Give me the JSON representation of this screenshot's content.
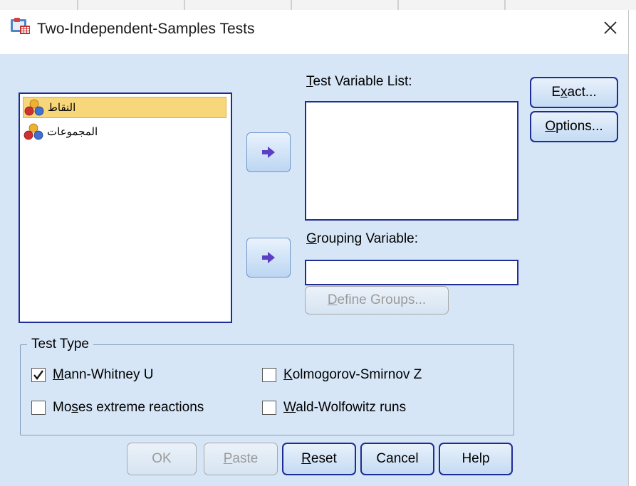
{
  "window": {
    "title": "Two-Independent-Samples Tests",
    "close_symbol": "✕"
  },
  "source_list": {
    "items": [
      {
        "label": "النقاط",
        "selected": true,
        "icon": "nominal-variable-icon"
      },
      {
        "label": "المجموعات",
        "selected": false,
        "icon": "nominal-variable-icon"
      }
    ]
  },
  "test_variable": {
    "label_key": "T",
    "label_rest": "est Variable List:"
  },
  "grouping_variable": {
    "label_key": "G",
    "label_rest": "rouping Variable:",
    "value": ""
  },
  "side_buttons": {
    "exact_pre": "E",
    "exact_key": "x",
    "exact_post": "act...",
    "options_key": "O",
    "options_post": "ptions..."
  },
  "define_groups": {
    "key": "D",
    "rest": "efine Groups..."
  },
  "test_type": {
    "legend": "Test Type",
    "mann_whitney": {
      "key": "M",
      "rest": "ann-Whitney U",
      "checked": true
    },
    "moses": {
      "pre": "Mo",
      "key": "s",
      "rest": "es extreme reactions",
      "checked": false
    },
    "kolmogorov": {
      "key": "K",
      "rest": "olmogorov-Smirnov Z",
      "checked": false
    },
    "wald": {
      "key": "W",
      "rest": "ald-Wolfowitz runs",
      "checked": false
    }
  },
  "footer": {
    "ok": "OK",
    "paste_key": "P",
    "paste_rest": "aste",
    "reset_key": "R",
    "reset_rest": "eset",
    "cancel": "Cancel",
    "help": "Help"
  },
  "colors": {
    "dialog_bg": "#d6e6f7",
    "focus_border": "#1e2c96",
    "selection": "#f7d77a",
    "arrow": "#5b3fc4"
  }
}
